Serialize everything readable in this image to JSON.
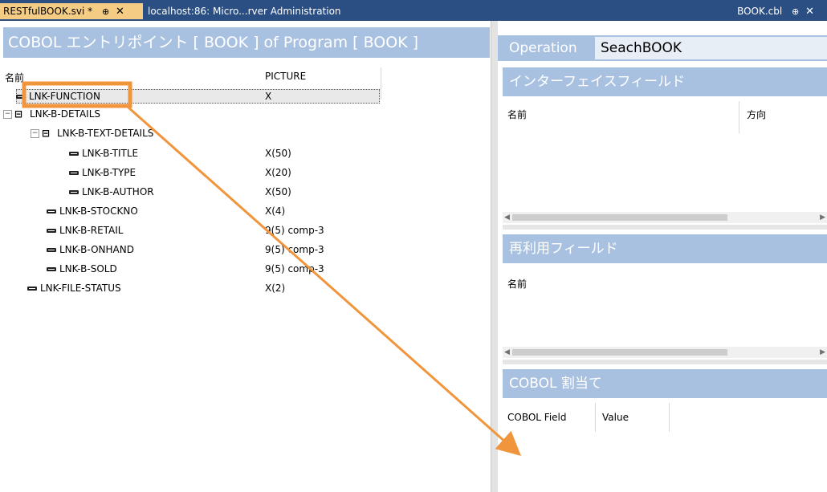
{
  "tabs": {
    "active": {
      "label": "RESTfulBOOK.svi *",
      "pin": "⊕",
      "close": "✕"
    },
    "second": {
      "label": "localhost:86: Micro...rver Administration"
    },
    "right": {
      "label": "BOOK.cbl",
      "pin": "⊕",
      "close": "✕"
    }
  },
  "left": {
    "header": "COBOL エントリポイント [ BOOK ] of Program [ BOOK ]",
    "col_name": "名前",
    "col_picture": "PICTURE",
    "rows": [
      {
        "name": "LNK-FUNCTION",
        "picture": "X"
      },
      {
        "name": "LNK-B-DETAILS",
        "picture": ""
      },
      {
        "name": "LNK-B-TEXT-DETAILS",
        "picture": ""
      },
      {
        "name": "LNK-B-TITLE",
        "picture": "X(50)"
      },
      {
        "name": "LNK-B-TYPE",
        "picture": "X(20)"
      },
      {
        "name": "LNK-B-AUTHOR",
        "picture": "X(50)"
      },
      {
        "name": "LNK-B-STOCKNO",
        "picture": "X(4)"
      },
      {
        "name": "LNK-B-RETAIL",
        "picture": "9(5) comp-3"
      },
      {
        "name": "LNK-B-ONHAND",
        "picture": "9(5) comp-3"
      },
      {
        "name": "LNK-B-SOLD",
        "picture": "9(5) comp-3"
      },
      {
        "name": "LNK-FILE-STATUS",
        "picture": "X(2)"
      }
    ]
  },
  "right": {
    "operation_label": "Operation",
    "operation_value": "SeachBOOK",
    "interface": {
      "title": "インターフェイスフィールド",
      "col_name": "名前",
      "col_direction": "方向"
    },
    "reuse": {
      "title": "再利用フィールド",
      "col_name": "名前"
    },
    "cobol": {
      "title": "COBOL 割当て",
      "col_field": "COBOL Field",
      "col_value": "Value"
    }
  },
  "colors": {
    "accent": "#a9c1e0",
    "tab_bar": "#2b4f83",
    "active_tab": "#f5cc84",
    "annotation": "#f0953c"
  }
}
